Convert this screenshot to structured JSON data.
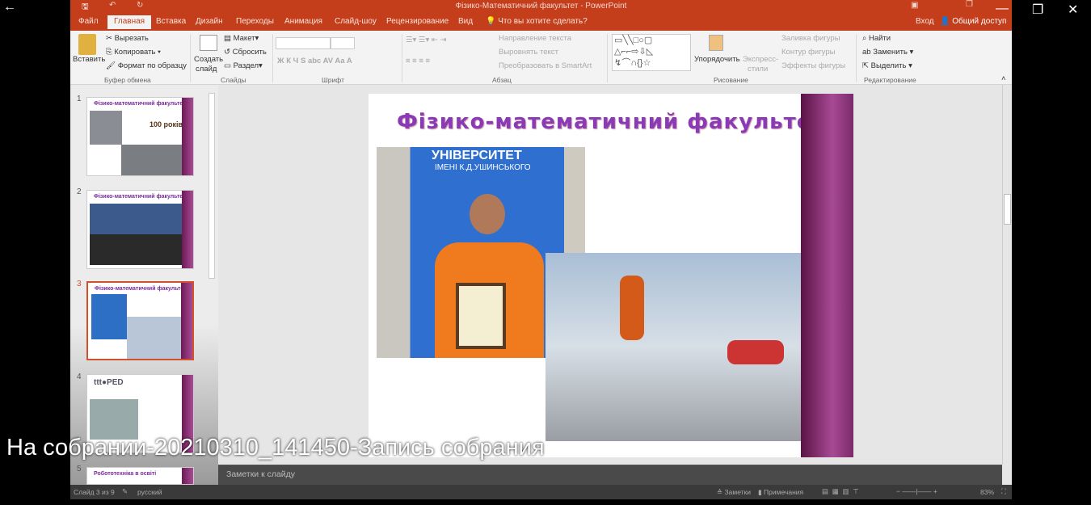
{
  "app": {
    "title": "Фізико-Математичний факультет - PowerPoint",
    "signin": "Вход",
    "share": "Общий доступ"
  },
  "tabs": [
    "Файл",
    "Главная",
    "Вставка",
    "Дизайн",
    "Переходы",
    "Анимация",
    "Слайд-шоу",
    "Рецензирование",
    "Вид"
  ],
  "tell_me": "Что вы хотите сделать?",
  "ribbon": {
    "paste": "Вставить",
    "cut": "Вырезать",
    "copy": "Копировать",
    "format_painter": "Формат по образцу",
    "clipboard": "Буфер обмена",
    "new_slide": "Создать",
    "new_slide2": "слайд",
    "layout": "Макет",
    "reset": "Сбросить",
    "section": "Раздел",
    "slides": "Слайды",
    "font": "Шрифт",
    "font_btns": "Ж  К  Ч  S  abc  AV  Aa  A",
    "text_dir": "Направление текста",
    "align_text": "Выровнять текст",
    "smartart": "Преобразовать в SmartArt",
    "paragraph": "Абзац",
    "arrange": "Упорядочить",
    "quick_styles": "Экспресс-",
    "quick_styles2": "стили",
    "fill": "Заливка фигуры",
    "outline": "Контур фигуры",
    "effects": "Эффекты фигуры",
    "drawing": "Рисование",
    "find": "Найти",
    "replace": "Заменить",
    "select": "Выделить",
    "editing": "Редактирование"
  },
  "thumbnails": [
    {
      "num": "1",
      "title": "Фізико-математичний факультет",
      "extra": "100 років"
    },
    {
      "num": "2",
      "title": "Фізико-математичний факультет",
      "extra": ""
    },
    {
      "num": "3",
      "title": "Фізико-математичний факультет",
      "extra": ""
    },
    {
      "num": "4",
      "title": "",
      "extra": "ttt●PED"
    },
    {
      "num": "5",
      "title": "Робототехніка в освіті",
      "extra": ""
    }
  ],
  "slide": {
    "title": "Фізико-математичний факультет",
    "banner1": "УНІВЕРСИТЕТ",
    "banner2": "ІМЕНІ К.Д.УШИНСЬКОГО"
  },
  "notes_placeholder": "Заметки к слайду",
  "status": {
    "slide": "Слайд 3 из 9",
    "lang": "русский",
    "notes": "Заметки",
    "comments": "Примечания",
    "zoom": "83%"
  },
  "video": {
    "title": "На собрании-20210310_141450-Запись собрания"
  }
}
